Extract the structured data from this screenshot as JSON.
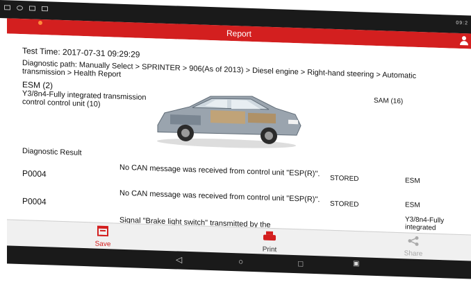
{
  "window": {
    "title": "Report",
    "status_time": "09:2"
  },
  "report": {
    "test_time": "Test Time: 2017-07-31 09:29:29",
    "diagnostic_path": "Diagnostic path: Manually Select > SPRINTER > 906(As of 2013) > Diesel engine > Right-hand steering > Automatic transmission > Health Report",
    "modules": {
      "esm": "ESM (2)",
      "y3": "Y3/8n4-Fully integrated transmission control control unit (10)",
      "sam": "SAM (16)"
    },
    "result_heading": "Diagnostic Result",
    "rows": [
      {
        "code": "P0004",
        "message": "No CAN message was received from control unit \"ESP(R)\".",
        "status": "STORED",
        "unit": "ESM"
      },
      {
        "code": "P0004",
        "message": "No CAN message was received from control unit \"ESP(R)\".",
        "status": "STORED",
        "unit": "ESM",
        "unit_extra": "Y3/8n4-Fully integrated"
      },
      {
        "message": "Signal \"Brake light switch\" transmitted by the"
      }
    ]
  },
  "toolbar": {
    "save_label": "Save",
    "print_label": "Print",
    "share_label": "Share"
  },
  "navigation": {
    "back": "◁",
    "home": "○",
    "recent": "□",
    "screenshot": "▣"
  },
  "icons": {
    "save": "calendar-save-icon",
    "print": "printer-icon",
    "share": "share-icon",
    "user": "user-icon"
  },
  "colors": {
    "accent": "#d31f1f",
    "status_bar": "#1a1a1a",
    "toolbar": "#f0f0f0"
  }
}
